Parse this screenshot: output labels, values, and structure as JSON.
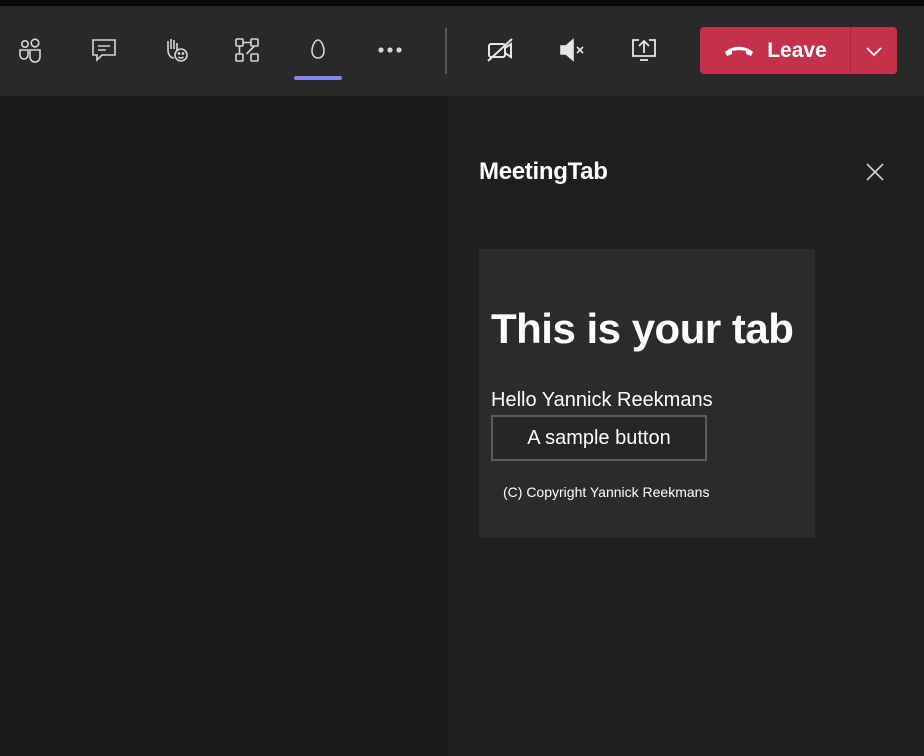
{
  "toolbar": {
    "icons": {
      "participants": "people-icon",
      "chat": "chat-icon",
      "reactions": "raise-hand-icon",
      "rooms": "breakout-rooms-icon",
      "app": "meeting-app-icon",
      "more": "more-options-icon",
      "camera": "camera-off-icon",
      "mic": "speaker-muted-icon",
      "share": "share-screen-icon"
    },
    "leave_label": "Leave",
    "leave_color": "#c4314b",
    "active_indicator_color": "#7f85f5"
  },
  "panel": {
    "title": "MeetingTab",
    "tab": {
      "heading": "This is your tab",
      "greeting": "Hello Yannick Reekmans",
      "button_label": "A sample button",
      "copyright": "(C) Copyright Yannick Reekmans"
    }
  }
}
